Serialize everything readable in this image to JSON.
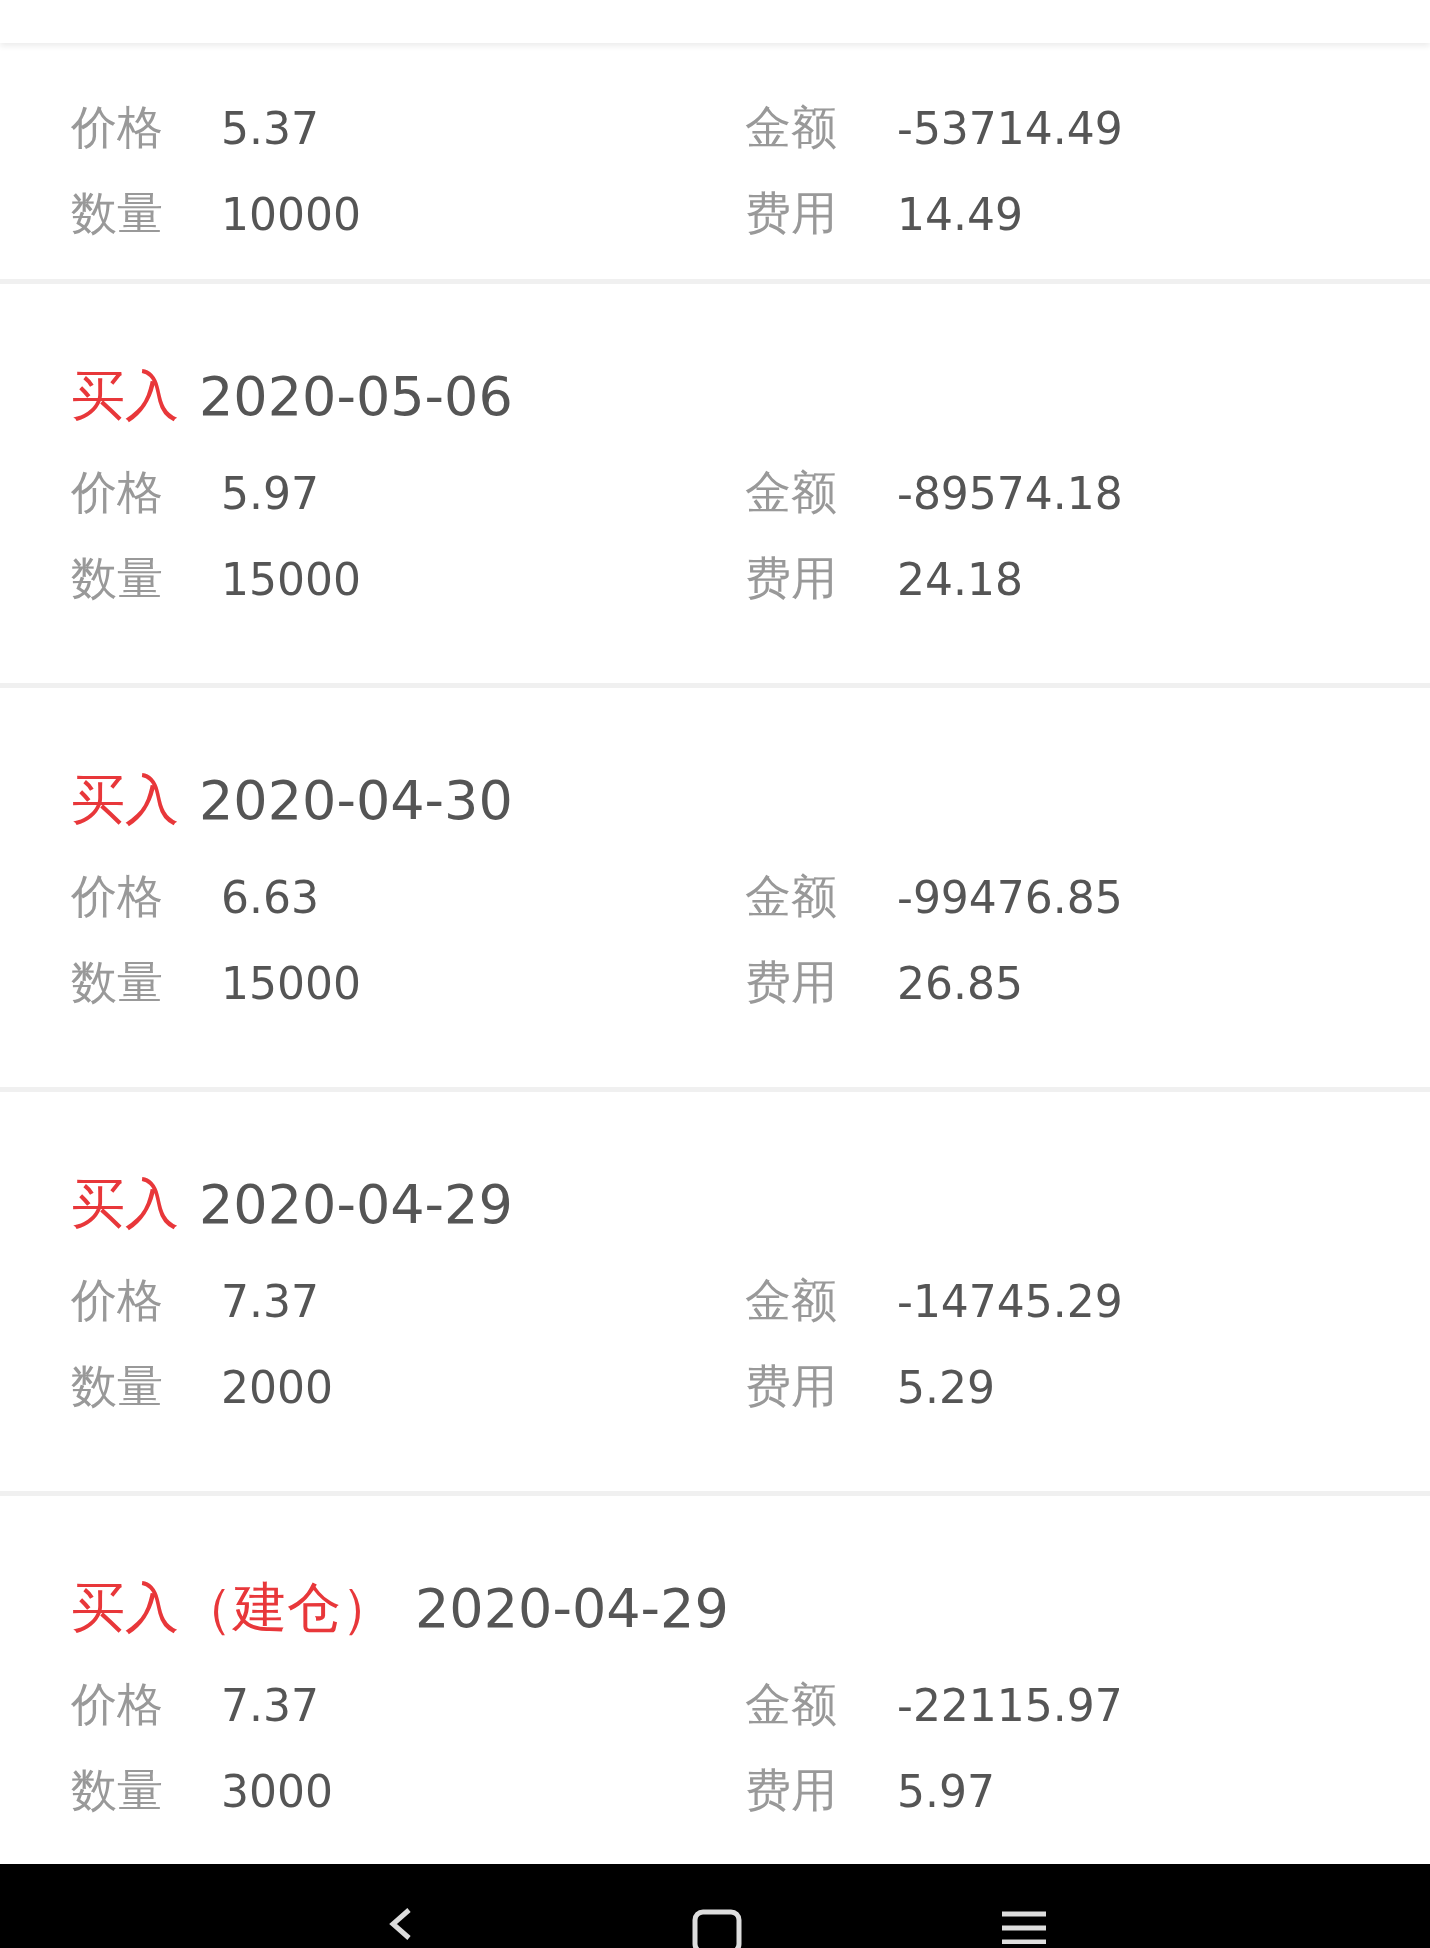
{
  "trades": [
    {
      "fields": [
        {
          "label": "价格",
          "value": "5.37"
        },
        {
          "label": "金额",
          "value": "-53714.49"
        },
        {
          "label": "数量",
          "value": "10000"
        },
        {
          "label": "费用",
          "value": "14.49"
        }
      ]
    },
    {
      "title": {
        "action": "买入",
        "date": "2020-05-06"
      },
      "fields": [
        {
          "label": "价格",
          "value": "5.97"
        },
        {
          "label": "金额",
          "value": "-89574.18"
        },
        {
          "label": "数量",
          "value": "15000"
        },
        {
          "label": "费用",
          "value": "24.18"
        }
      ]
    },
    {
      "title": {
        "action": "买入",
        "date": "2020-04-30"
      },
      "fields": [
        {
          "label": "价格",
          "value": "6.63"
        },
        {
          "label": "金额",
          "value": "-99476.85"
        },
        {
          "label": "数量",
          "value": "15000"
        },
        {
          "label": "费用",
          "value": "26.85"
        }
      ]
    },
    {
      "title": {
        "action": "买入",
        "date": "2020-04-29"
      },
      "fields": [
        {
          "label": "价格",
          "value": "7.37"
        },
        {
          "label": "金额",
          "value": "-14745.29"
        },
        {
          "label": "数量",
          "value": "2000"
        },
        {
          "label": "费用",
          "value": "5.29"
        }
      ]
    },
    {
      "title": {
        "action": "买入（建仓）",
        "date": "2020-04-29"
      },
      "fields": [
        {
          "label": "价格",
          "value": "7.37"
        },
        {
          "label": "金额",
          "value": "-22115.97"
        },
        {
          "label": "数量",
          "value": "3000"
        },
        {
          "label": "费用",
          "value": "5.97"
        }
      ]
    }
  ]
}
